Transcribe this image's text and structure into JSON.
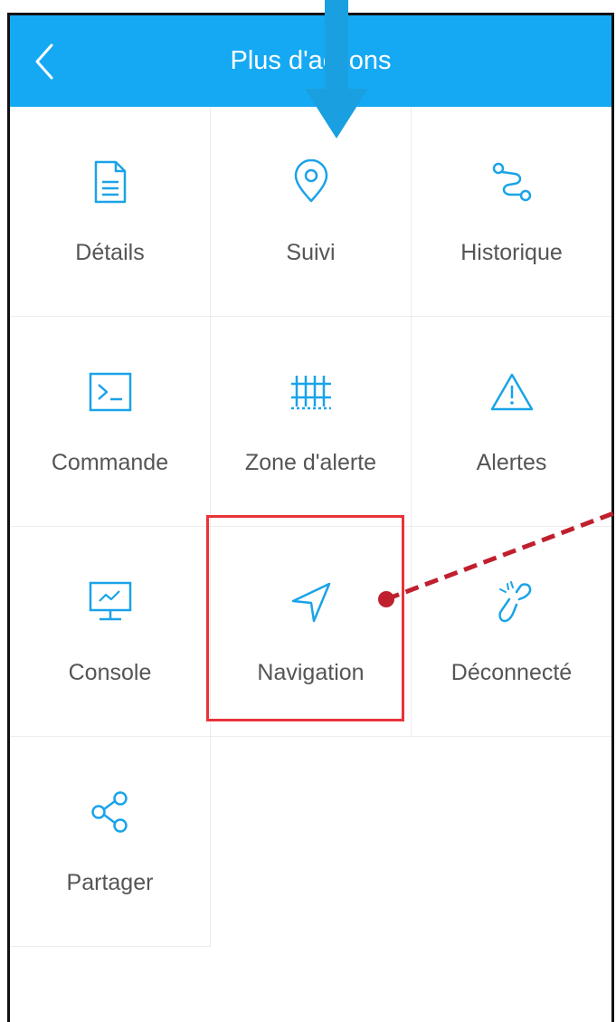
{
  "header": {
    "title": "Plus d'actions",
    "background": "#16a9f3"
  },
  "actions": [
    {
      "label": "Détails",
      "icon": "document-icon"
    },
    {
      "label": "Suivi",
      "icon": "location-pin-icon"
    },
    {
      "label": "Historique",
      "icon": "route-icon"
    },
    {
      "label": "Commande",
      "icon": "terminal-icon"
    },
    {
      "label": "Zone d'alerte",
      "icon": "fence-icon"
    },
    {
      "label": "Alertes",
      "icon": "warning-icon"
    },
    {
      "label": "Console",
      "icon": "monitor-chart-icon"
    },
    {
      "label": "Navigation",
      "icon": "navigation-arrow-icon"
    },
    {
      "label": "Déconnecté",
      "icon": "broken-link-icon"
    },
    {
      "label": "Partager",
      "icon": "share-icon"
    }
  ],
  "colors": {
    "icon": "#1aa3e8",
    "label": "#555555",
    "highlight": "#e8333a",
    "annotation_arrow": "#c0202e",
    "pointer_arrow": "#1aa0e0"
  },
  "annotation": {
    "highlighted_item": "Navigation"
  }
}
